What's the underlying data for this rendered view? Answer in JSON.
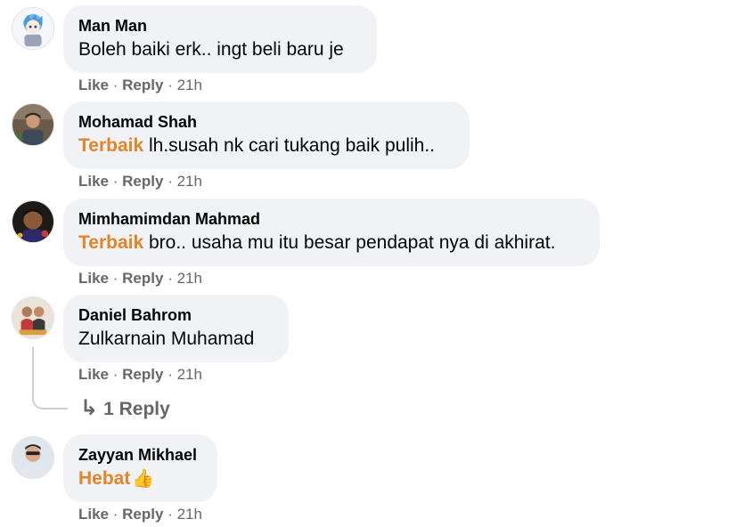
{
  "comments": [
    {
      "author": "Man Man",
      "tag": "",
      "text": "Boleh baiki erk.. ingt beli baru je",
      "like": "Like",
      "reply": "Reply",
      "time": "21h",
      "avatar_icon": "anime-avatar-icon"
    },
    {
      "author": "Mohamad Shah",
      "tag": "Terbaik",
      "text": " lh.susah nk cari tukang baik pulih..",
      "like": "Like",
      "reply": "Reply",
      "time": "21h",
      "avatar_icon": "profile-photo-icon"
    },
    {
      "author": "Mimhamimdan Mahmad",
      "tag": "Terbaik",
      "text": " bro.. usaha mu itu besar pendapat nya di akhirat.",
      "like": "Like",
      "reply": "Reply",
      "time": "21h",
      "avatar_icon": "profile-photo-icon"
    },
    {
      "author": "Daniel Bahrom",
      "tag": "",
      "text": "Zulkarnain Muhamad",
      "like": "Like",
      "reply": "Reply",
      "time": "21h",
      "avatar_icon": "profile-photo-icon"
    },
    {
      "author": "Zayyan Mikhael",
      "tag": "Hebat",
      "text": "👍",
      "like": "Like",
      "reply": "Reply",
      "time": "21h",
      "avatar_icon": "profile-photo-icon"
    }
  ],
  "replies_link": "1 Reply",
  "separator": "·",
  "colors": {
    "bubble": "#f0f2f5",
    "tag": "#e0852a",
    "meta": "#65676b"
  }
}
